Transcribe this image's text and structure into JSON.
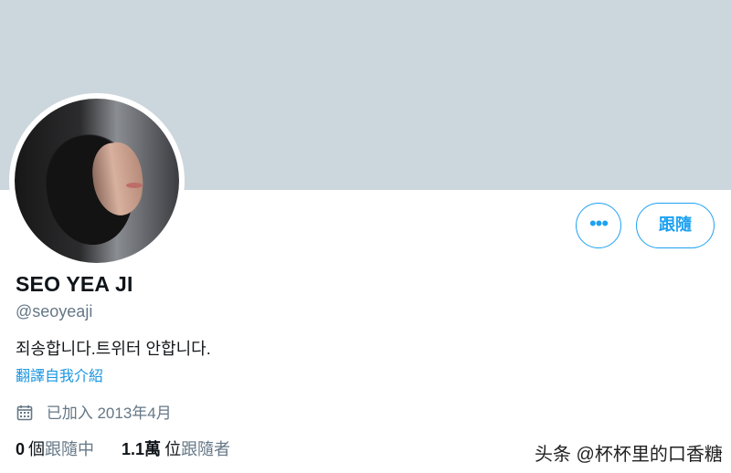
{
  "profile": {
    "display_name": "SEO YEA JI",
    "handle": "@seoyeaji",
    "bio": "죄송합니다.트위터 안합니다.",
    "translate_label": "翻譯自我介紹",
    "joined_label": "已加入 2013年4月",
    "avatar_icon": "profile-photo"
  },
  "actions": {
    "more_label": "•••",
    "follow_label": "跟隨"
  },
  "stats": {
    "following_count": "0",
    "following_unit": "個",
    "following_label": "跟隨中",
    "followers_count": "1.1萬",
    "followers_unit": "位",
    "followers_label": "跟隨者"
  },
  "watermark": {
    "text": "头条 @杯杯里的口香糖"
  },
  "colors": {
    "banner": "#ccd6dd",
    "accent": "#1da1f2",
    "muted_text": "#657786",
    "primary_text": "#0f1419"
  }
}
